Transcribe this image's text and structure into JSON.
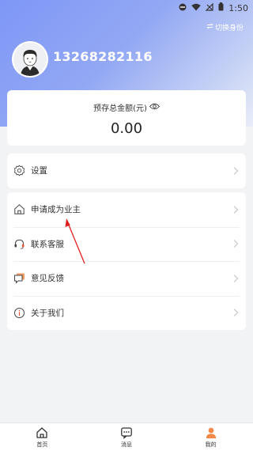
{
  "status_bar": {
    "time": "1:50"
  },
  "header": {
    "switch_identity": "切换身份",
    "phone": "13268282116"
  },
  "balance": {
    "label": "预存总金额(元)",
    "value": "0.00"
  },
  "menu": {
    "settings": "设置",
    "apply_owner": "申请成为业主",
    "contact_service": "联系客服",
    "feedback": "意见反馈",
    "about_us": "关于我们"
  },
  "tabbar": {
    "items": [
      {
        "label": "首页",
        "icon": "home-icon"
      },
      {
        "label": "消息",
        "icon": "message-icon"
      },
      {
        "label": "我的",
        "icon": "user-icon"
      }
    ],
    "active_index": 2
  },
  "colors": {
    "hero_start": "#7e97f6",
    "hero_end": "#e9edf8",
    "accent": "#f5894a",
    "annotation_arrow": "#e02020"
  }
}
